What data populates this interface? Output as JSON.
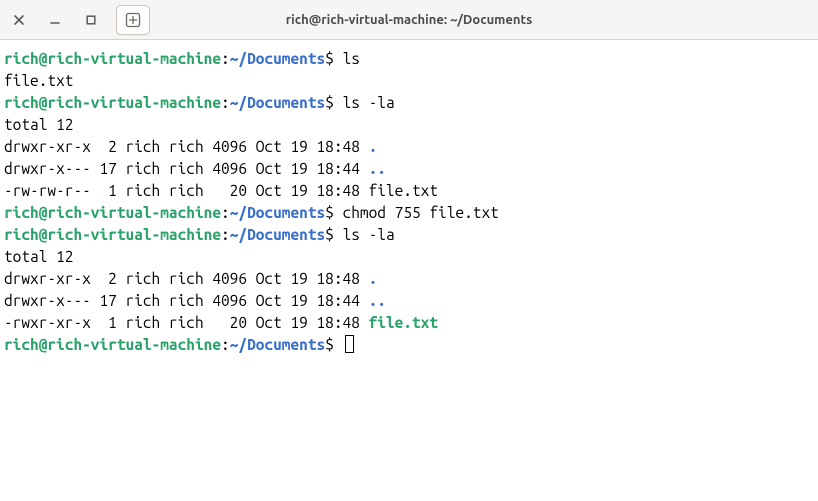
{
  "window": {
    "title": "rich@rich-virtual-machine: ~/Documents"
  },
  "colors": {
    "user": "#2aa36a",
    "path": "#3a6fc9",
    "executable": "#2aa36a"
  },
  "prompt": {
    "user": "rich@rich-virtual-machine",
    "sep": ":",
    "path": "~/Documents",
    "symbol": "$ "
  },
  "session": [
    {
      "type": "cmd",
      "text": "ls"
    },
    {
      "type": "out",
      "text": "file.txt"
    },
    {
      "type": "cmd",
      "text": "ls -la"
    },
    {
      "type": "out",
      "text": "total 12"
    },
    {
      "type": "out",
      "text": "drwxr-xr-x  2 rich rich 4096 Oct 19 18:48 ",
      "trailing": ".",
      "trailingClass": "dot"
    },
    {
      "type": "out",
      "text": "drwxr-x--- 17 rich rich 4096 Oct 19 18:44 ",
      "trailing": "..",
      "trailingClass": "dot"
    },
    {
      "type": "out",
      "text": "-rw-rw-r--  1 rich rich   20 Oct 19 18:48 file.txt"
    },
    {
      "type": "cmd",
      "text": "chmod 755 file.txt"
    },
    {
      "type": "cmd",
      "text": "ls -la"
    },
    {
      "type": "out",
      "text": "total 12"
    },
    {
      "type": "out",
      "text": "drwxr-xr-x  2 rich rich 4096 Oct 19 18:48 ",
      "trailing": ".",
      "trailingClass": "dot"
    },
    {
      "type": "out",
      "text": "drwxr-x--- 17 rich rich 4096 Oct 19 18:44 ",
      "trailing": "..",
      "trailingClass": "dot"
    },
    {
      "type": "out",
      "text": "-rwxr-xr-x  1 rich rich   20 Oct 19 18:48 ",
      "trailing": "file.txt",
      "trailingClass": "exe"
    },
    {
      "type": "cmd",
      "text": "",
      "cursor": true
    }
  ]
}
